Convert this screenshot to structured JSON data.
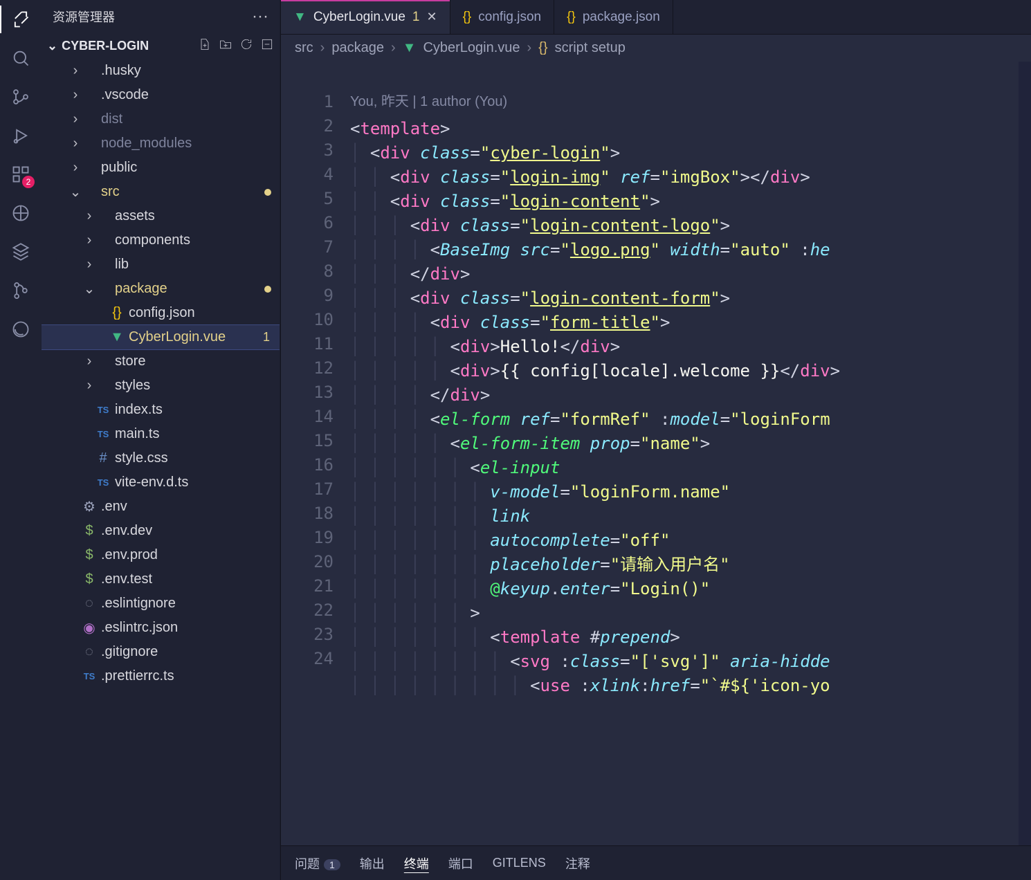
{
  "sidebar": {
    "title": "资源管理器",
    "repo": "CYBER-LOGIN",
    "tree": [
      {
        "d": 1,
        "chev": ">",
        "icon": "",
        "label": ".husky",
        "cls": ""
      },
      {
        "d": 1,
        "chev": ">",
        "icon": "",
        "label": ".vscode",
        "cls": ""
      },
      {
        "d": 1,
        "chev": ">",
        "icon": "",
        "label": "dist",
        "cls": "muted"
      },
      {
        "d": 1,
        "chev": ">",
        "icon": "",
        "label": "node_modules",
        "cls": "muted"
      },
      {
        "d": 1,
        "chev": ">",
        "icon": "",
        "label": "public",
        "cls": ""
      },
      {
        "d": 1,
        "chev": "v",
        "icon": "",
        "label": "src",
        "cls": "mod",
        "dot": true
      },
      {
        "d": 2,
        "chev": ">",
        "icon": "",
        "label": "assets",
        "cls": ""
      },
      {
        "d": 2,
        "chev": ">",
        "icon": "",
        "label": "components",
        "cls": ""
      },
      {
        "d": 2,
        "chev": ">",
        "icon": "",
        "label": "lib",
        "cls": ""
      },
      {
        "d": 2,
        "chev": "v",
        "icon": "",
        "label": "package",
        "cls": "mod",
        "dot": true
      },
      {
        "d": 3,
        "chev": "",
        "icon": "json",
        "label": "config.json",
        "cls": ""
      },
      {
        "d": 3,
        "chev": "",
        "icon": "vue",
        "label": "CyberLogin.vue",
        "cls": "mod sel",
        "count": "1"
      },
      {
        "d": 2,
        "chev": ">",
        "icon": "",
        "label": "store",
        "cls": ""
      },
      {
        "d": 2,
        "chev": ">",
        "icon": "",
        "label": "styles",
        "cls": ""
      },
      {
        "d": 2,
        "chev": "",
        "icon": "ts",
        "label": "index.ts",
        "cls": ""
      },
      {
        "d": 2,
        "chev": "",
        "icon": "ts",
        "label": "main.ts",
        "cls": ""
      },
      {
        "d": 2,
        "chev": "",
        "icon": "hash",
        "label": "style.css",
        "cls": ""
      },
      {
        "d": 2,
        "chev": "",
        "icon": "ts",
        "label": "vite-env.d.ts",
        "cls": ""
      },
      {
        "d": 1,
        "chev": "",
        "icon": "gear",
        "label": ".env",
        "cls": ""
      },
      {
        "d": 1,
        "chev": "",
        "icon": "dollar",
        "label": ".env.dev",
        "cls": ""
      },
      {
        "d": 1,
        "chev": "",
        "icon": "dollar",
        "label": ".env.prod",
        "cls": ""
      },
      {
        "d": 1,
        "chev": "",
        "icon": "dollar",
        "label": ".env.test",
        "cls": ""
      },
      {
        "d": 1,
        "chev": "",
        "icon": "ign",
        "label": ".eslintignore",
        "cls": ""
      },
      {
        "d": 1,
        "chev": "",
        "icon": "es",
        "label": ".eslintrc.json",
        "cls": ""
      },
      {
        "d": 1,
        "chev": "",
        "icon": "ign",
        "label": ".gitignore",
        "cls": ""
      },
      {
        "d": 1,
        "chev": "",
        "icon": "ts",
        "label": ".prettierrc.ts",
        "cls": ""
      }
    ]
  },
  "tabs": [
    {
      "icon": "vue",
      "label": "CyberLogin.vue",
      "dirty": "1",
      "active": true,
      "close": true
    },
    {
      "icon": "json",
      "label": "config.json",
      "active": false
    },
    {
      "icon": "json",
      "label": "package.json",
      "active": false
    }
  ],
  "breadcrumb": {
    "p1": "src",
    "p2": "package",
    "icon": "vue",
    "file": "CyberLogin.vue",
    "sym_icon": "{}",
    "sym": "script setup"
  },
  "codelens": "You, 昨天 | 1 author (You)",
  "code": {
    "l1": {
      "a": "<",
      "b": "template",
      "c": ">"
    },
    "l2": {
      "a": "<",
      "b": "div",
      "c": " ",
      "d": "class",
      "e": "=",
      "f": "\"",
      "g": "cyber-login",
      "h": "\"",
      "i": ">"
    },
    "l3": {
      "a": "<",
      "b": "div",
      "c": " ",
      "d": "class",
      "e": "=",
      "f": "\"",
      "g": "login-img",
      "h": "\"",
      "i": " ",
      "j": "ref",
      "k": "=",
      "l": "\"",
      "m": "imgBox",
      "n": "\"",
      "o": "></",
      "p": "div",
      "q": ">"
    },
    "l4": {
      "a": "<",
      "b": "div",
      "c": " ",
      "d": "class",
      "e": "=",
      "f": "\"",
      "g": "login-content",
      "h": "\"",
      "i": ">"
    },
    "l5": {
      "a": "<",
      "b": "div",
      "c": " ",
      "d": "class",
      "e": "=",
      "f": "\"",
      "g": "login-content-logo",
      "h": "\"",
      "i": ">"
    },
    "l6": {
      "a": "<",
      "b": "BaseImg",
      "c": " ",
      "d": "src",
      "e": "=",
      "f": "\"",
      "g": "logo.png",
      "h": "\"",
      "i": " ",
      "j": "width",
      "k": "=",
      "l": "\"",
      "m": "auto",
      "n": "\"",
      "o": " :",
      "p": "he"
    },
    "l7": {
      "a": "</",
      "b": "div",
      "c": ">"
    },
    "l8": {
      "a": "<",
      "b": "div",
      "c": " ",
      "d": "class",
      "e": "=",
      "f": "\"",
      "g": "login-content-form",
      "h": "\"",
      "i": ">"
    },
    "l9": {
      "a": "<",
      "b": "div",
      "c": " ",
      "d": "class",
      "e": "=",
      "f": "\"",
      "g": "form-title",
      "h": "\"",
      "i": ">"
    },
    "l10": {
      "a": "<",
      "b": "div",
      "c": ">",
      "d": "Hello!",
      "e": "</",
      "f": "div",
      "g": ">"
    },
    "l11": {
      "a": "<",
      "b": "div",
      "c": ">",
      "d": "{{ config[locale].welcome }}",
      "e": "</",
      "f": "div",
      "g": ">"
    },
    "l12": {
      "a": "</",
      "b": "div",
      "c": ">"
    },
    "l13": {
      "a": "<",
      "b": "el-form",
      "c": " ",
      "d": "ref",
      "e": "=",
      "f": "\"",
      "g": "formRef",
      "h": "\"",
      "i": " :",
      "j": "model",
      "k": "=",
      "l": "\"",
      "m": "loginForm",
      "n": ""
    },
    "l14": {
      "a": "<",
      "b": "el-form-item",
      "c": " ",
      "d": "prop",
      "e": "=",
      "f": "\"",
      "g": "name",
      "h": "\"",
      "i": ">"
    },
    "l15": {
      "a": "<",
      "b": "el-input"
    },
    "l16": {
      "a": "v-model",
      "b": "=",
      "c": "\"",
      "d": "loginForm.name",
      "e": "\""
    },
    "l17": {
      "a": "link"
    },
    "l18": {
      "a": "autocomplete",
      "b": "=",
      "c": "\"",
      "d": "off",
      "e": "\""
    },
    "l19": {
      "a": "placeholder",
      "b": "=",
      "c": "\"",
      "d": "请输入用户名",
      "e": "\""
    },
    "l20": {
      "a": "@",
      "b": "keyup",
      "c": ".",
      "d": "enter",
      "e": "=",
      "f": "\"",
      "g": "Login()",
      "h": "\""
    },
    "l21": {
      "a": ">"
    },
    "l22": {
      "a": "<",
      "b": "template",
      "c": " #",
      "d": "prepend",
      "e": ">"
    },
    "l23": {
      "a": "<",
      "b": "svg",
      "c": " :",
      "d": "class",
      "e": "=",
      "f": "\"",
      "g": "['svg']",
      "h": "\"",
      "i": " ",
      "j": "aria-hidde"
    },
    "l24": {
      "a": "<",
      "b": "use",
      "c": " :",
      "d": "xlink",
      "e": ":",
      "f": "href",
      "g": "=",
      "h": "\"",
      "i": "`#${'icon-yo"
    }
  },
  "panel": {
    "p1": "问题",
    "badge": "1",
    "p2": "输出",
    "p3": "终端",
    "p4": "端口",
    "p5": "GITLENS",
    "p6": "注释"
  }
}
